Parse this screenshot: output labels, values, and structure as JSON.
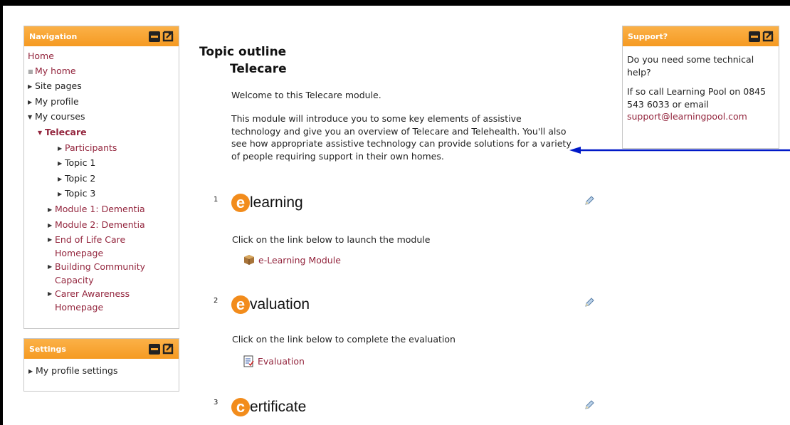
{
  "navigation": {
    "title": "Navigation",
    "home": "Home",
    "my_home": "My home",
    "site_pages": "Site pages",
    "my_profile": "My profile",
    "my_courses": "My courses",
    "current_course": "Telecare",
    "course_children": [
      "Participants",
      "Topic 1",
      "Topic 2",
      "Topic 3"
    ],
    "other_courses": [
      "Module 1: Dementia",
      "Module 2: Dementia",
      "End of Life Care Homepage",
      "Building Community Capacity",
      "Carer Awareness Homepage"
    ]
  },
  "settings": {
    "title": "Settings",
    "item": "My profile settings"
  },
  "support": {
    "title": "Support?",
    "line1": "Do you need some technical help?",
    "line2": "If so call Learning Pool on 0845 543 6033 or email",
    "email": "support@learningpool.com"
  },
  "main": {
    "heading": "Topic outline",
    "section0_title": "Telecare",
    "welcome": "Welcome to this Telecare module.",
    "intro": "This module will introduce you to some key elements of assistive technology and give you an overview of Telecare and Telehealth. You'll also see how appropriate assistive technology can provide solutions for a variety of people requiring support in their own homes.",
    "sections": [
      {
        "num": "1",
        "letter": "e",
        "rest": "learning",
        "desc": "Click on the link below to launch the module",
        "activity": "e-Learning Module",
        "activity_icon": "package-icon"
      },
      {
        "num": "2",
        "letter": "e",
        "rest": "valuation",
        "desc": "Click on the link below to complete the evaluation",
        "activity": "Evaluation",
        "activity_icon": "feedback-icon"
      },
      {
        "num": "3",
        "letter": "c",
        "rest": "ertificate"
      }
    ]
  },
  "colors": {
    "accent_orange": "#f59a22",
    "link": "#93253d",
    "annotation_arrow": "#0019c8"
  }
}
